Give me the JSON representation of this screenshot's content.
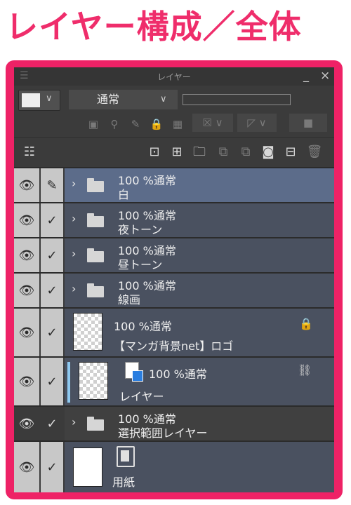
{
  "heading": "レイヤー構成／全体",
  "panel": {
    "title": "レイヤー",
    "grip_icon": "menu-grip-icon",
    "minimize": "_",
    "close": "×"
  },
  "toolbar": {
    "blend_mode": "通常",
    "chevron": "∨",
    "opacity_bar_fill": 0
  },
  "layers": [
    {
      "mode": "100 %通常",
      "name": "白"
    },
    {
      "mode": "100 %通常",
      "name": "夜トーン"
    },
    {
      "mode": "100 %通常",
      "name": "昼トーン"
    },
    {
      "mode": "100 %通常",
      "name": "線画"
    },
    {
      "mode": "100 %通常",
      "name": "【マンガ背景net】ロゴ"
    },
    {
      "mode": "100 %通常",
      "name": "レイヤー"
    },
    {
      "mode": "100 %通常",
      "name": "選択範囲レイヤー"
    },
    {
      "mode": "",
      "name": "用紙"
    }
  ],
  "glyphs": {
    "eye": "👁",
    "check": "✓",
    "pen": "✎",
    "arrow": "›",
    "lock": "🔒",
    "mask_link": "⛓"
  },
  "colors": {
    "accent": "#ee2266",
    "selected_row": "#5c6c8a",
    "folder_row": "#4a5160"
  }
}
